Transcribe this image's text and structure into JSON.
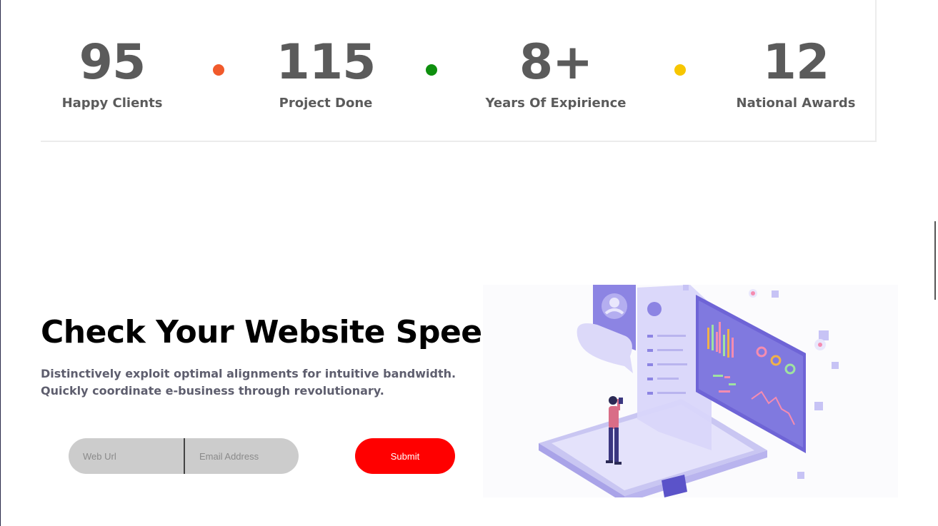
{
  "stats": [
    {
      "number": "95",
      "label": "Happy Clients"
    },
    {
      "number": "115",
      "label": "Project Done"
    },
    {
      "number": "8+",
      "label": "Years Of Expirience"
    },
    {
      "number": "12",
      "label": "National Awards"
    }
  ],
  "dots": [
    {
      "color": "#f15a2b"
    },
    {
      "color": "#0e8f0e"
    },
    {
      "color": "#f7c600"
    }
  ],
  "hero": {
    "title": "Check Your Website Speed",
    "description": "Distinctively exploit optimal alignments for intuitive bandwidth. Quickly coordinate e-business through revolutionary."
  },
  "form": {
    "url_placeholder": "Web Url",
    "email_placeholder": "Email Address",
    "submit_label": "Submit"
  },
  "colors": {
    "accent": "#ff0000",
    "stat_text": "#5b5b5b",
    "illustration_purple": "#7b6fe0"
  }
}
